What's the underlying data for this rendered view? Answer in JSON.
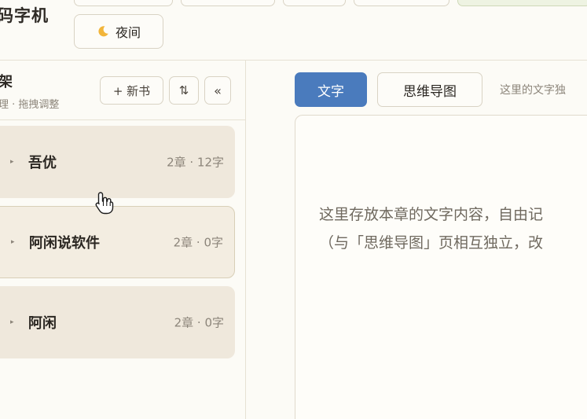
{
  "app": {
    "title": "码字机"
  },
  "toolbar": {
    "night_label": "夜间",
    "night_icon": "moon-icon"
  },
  "shelf": {
    "title": "架",
    "hint": "理 · 拖拽调整",
    "new_book_label": "+ 新书",
    "sort_label": "⇅",
    "collapse_label": "«",
    "books": [
      {
        "name": "吾优",
        "meta": "2章 · 12字",
        "selected": false
      },
      {
        "name": "阿闲说软件",
        "meta": "2章 · 0字",
        "selected": true
      },
      {
        "name": "阿闲",
        "meta": "2章 · 0字",
        "selected": false
      }
    ]
  },
  "tabs": {
    "text_label": "文字",
    "mindmap_label": "思维导图",
    "hint": "这里的文字独"
  },
  "editor": {
    "placeholder": "这里存放本章的文字内容，自由记\n（与「思维导图」页相互独立，改"
  },
  "colors": {
    "accent": "#4a7bbd",
    "card": "#efe8dc",
    "background": "#fcfbf6"
  }
}
